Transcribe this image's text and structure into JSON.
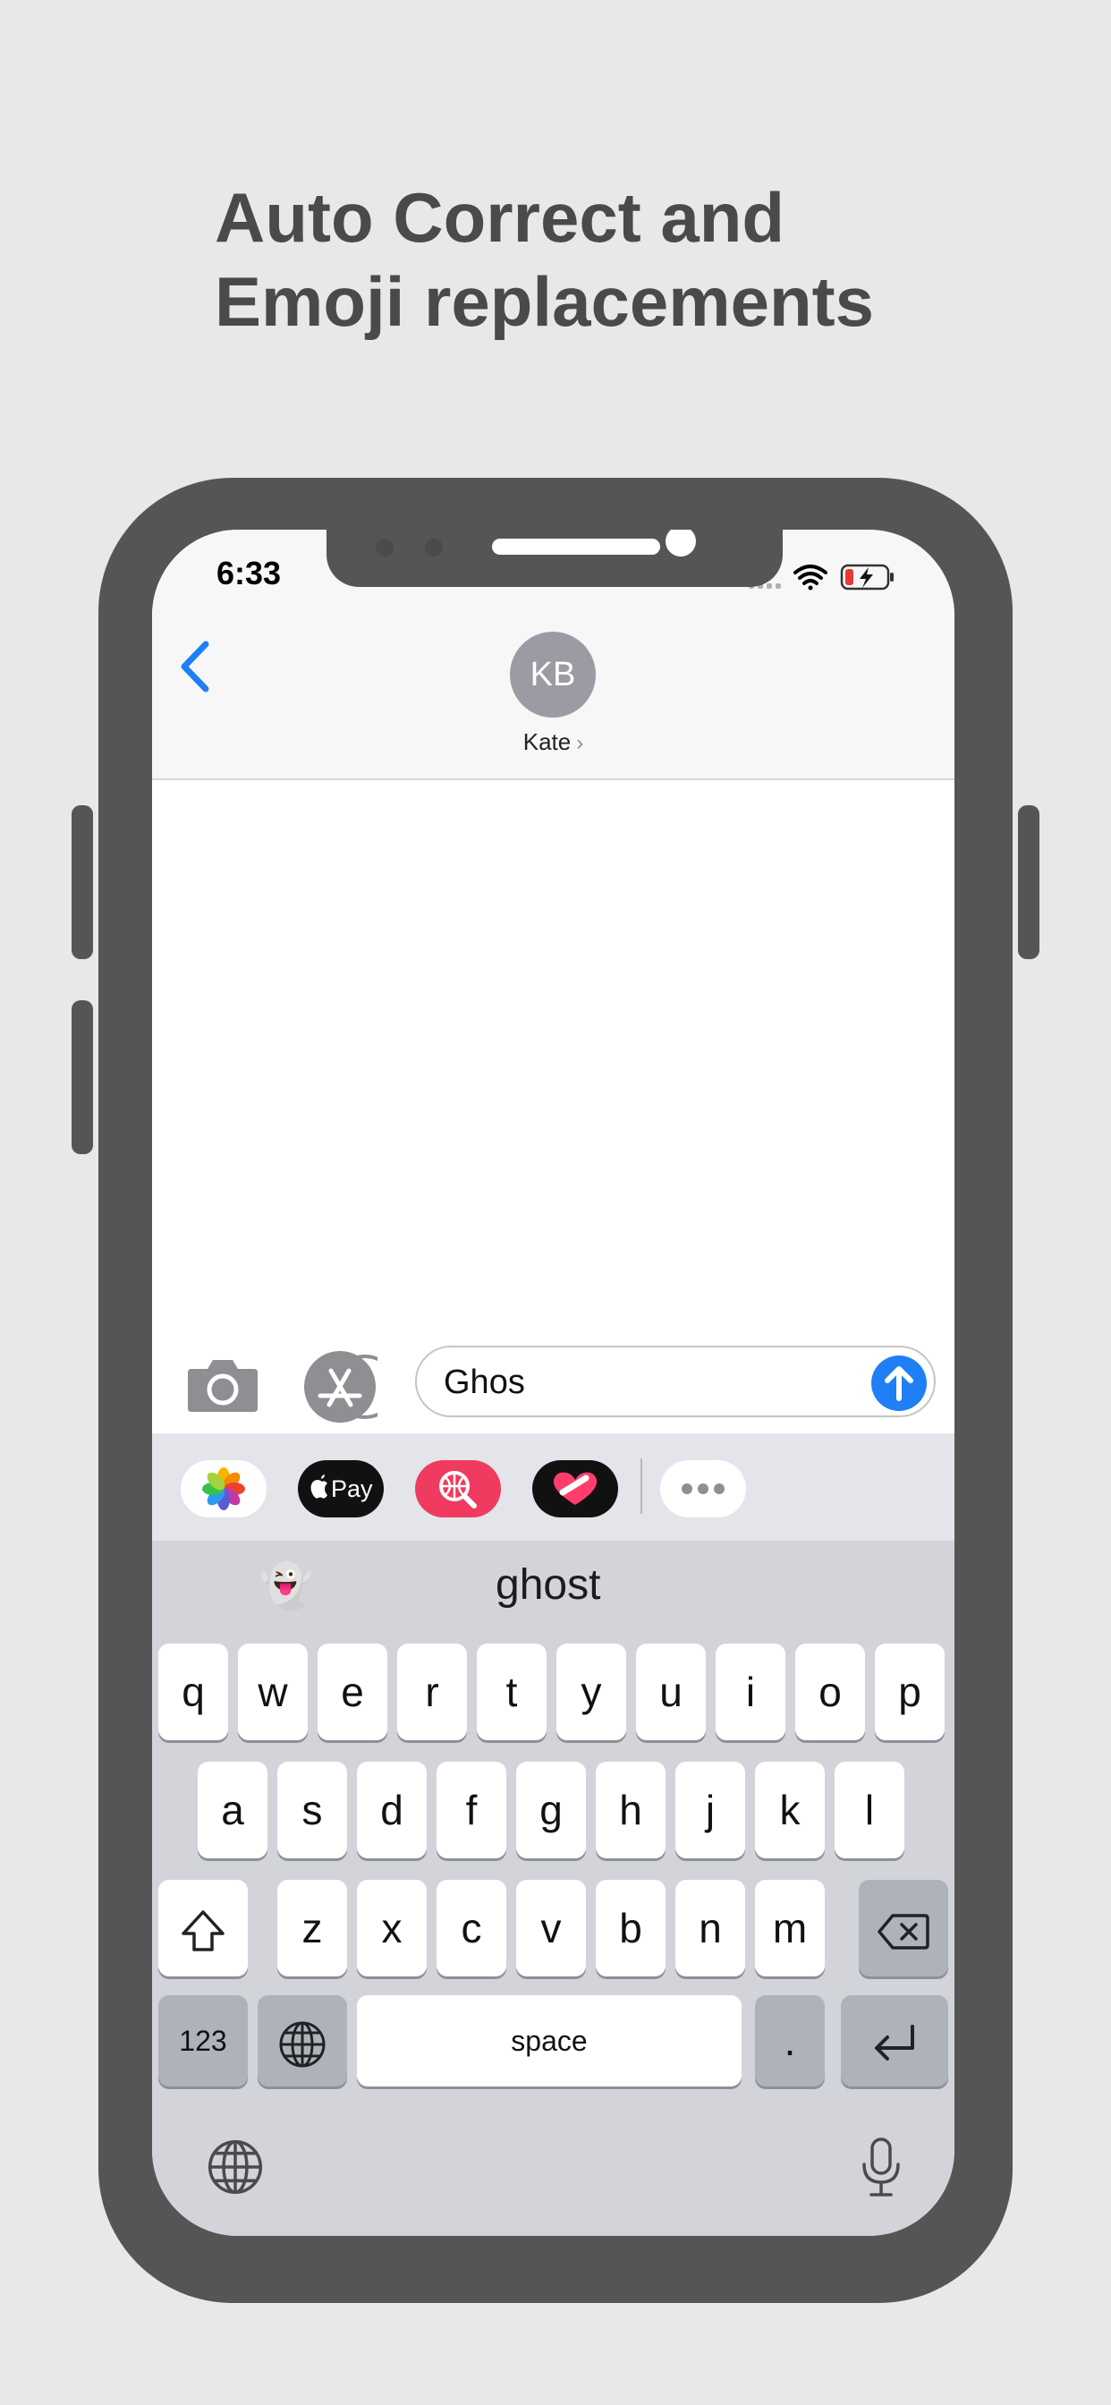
{
  "headline": {
    "line1": "Auto Correct and",
    "line2": "Emoji replacements"
  },
  "status_bar": {
    "time": "6:33",
    "signal_icon": "signal-dots-icon",
    "wifi_icon": "wifi-icon",
    "battery_icon": "battery-charging-icon",
    "battery_color": "#e53b32"
  },
  "conversation": {
    "avatar_initials": "KB",
    "contact_name": "Kate",
    "contact_chevron": "›",
    "back_icon": "chevron-left-icon",
    "accent": "#1f7ff4"
  },
  "composer": {
    "camera_icon": "camera-icon",
    "appstore_icon": "app-store-icon",
    "input_value": "Ghos",
    "send_icon": "arrow-up-icon"
  },
  "app_strip": [
    {
      "name": "photos-app",
      "icon": "photos-icon"
    },
    {
      "name": "apple-pay-app",
      "label": "Pay",
      "icon": "apple-pay-icon"
    },
    {
      "name": "image-search-app",
      "icon": "globe-search-icon"
    },
    {
      "name": "digital-touch-app",
      "icon": "heart-touch-icon"
    },
    {
      "name": "more-apps",
      "icon": "ellipsis-icon"
    }
  ],
  "suggestions": {
    "emoji": "👻",
    "word": "ghost"
  },
  "keyboard": {
    "row1": [
      "q",
      "w",
      "e",
      "r",
      "t",
      "y",
      "u",
      "i",
      "o",
      "p"
    ],
    "row2": [
      "a",
      "s",
      "d",
      "f",
      "g",
      "h",
      "j",
      "k",
      "l"
    ],
    "row3": [
      "z",
      "x",
      "c",
      "v",
      "b",
      "n",
      "m"
    ],
    "numbers_key": "123",
    "space_key": "space",
    "period_key": ".",
    "shift_icon": "shift-icon",
    "delete_icon": "delete-icon",
    "return_icon": "return-icon",
    "globe_icon": "globe-icon",
    "mic_icon": "microphone-icon"
  }
}
